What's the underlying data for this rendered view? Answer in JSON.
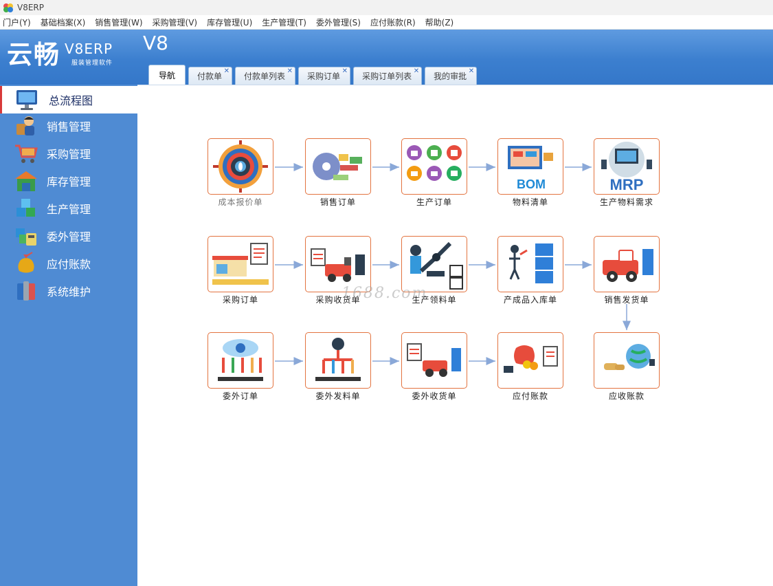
{
  "window": {
    "title": "V8ERP"
  },
  "menu": [
    "门户(Y)",
    "基础档案(X)",
    "销售管理(W)",
    "采购管理(V)",
    "库存管理(U)",
    "生产管理(T)",
    "委外管理(S)",
    "应付账款(R)",
    "帮助(Z)"
  ],
  "brand": {
    "name_cn": "云畅",
    "name_en": "V8ERP",
    "tagline": "服装管理软件",
    "version": "V8"
  },
  "tabs": [
    {
      "label": "导航",
      "closable": false,
      "active": true
    },
    {
      "label": "付款单",
      "closable": true
    },
    {
      "label": "付款单列表",
      "closable": true
    },
    {
      "label": "采购订单",
      "closable": true
    },
    {
      "label": "采购订单列表",
      "closable": true
    },
    {
      "label": "我的审批",
      "closable": true
    }
  ],
  "tab_close_glyph": "✕",
  "sidebar": [
    {
      "label": "总流程图",
      "icon": "monitor-icon",
      "active": true
    },
    {
      "label": "销售管理",
      "icon": "salesperson-icon"
    },
    {
      "label": "采购管理",
      "icon": "shopping-cart-icon"
    },
    {
      "label": "库存管理",
      "icon": "warehouse-icon"
    },
    {
      "label": "生产管理",
      "icon": "cubes-icon"
    },
    {
      "label": "委外管理",
      "icon": "outsource-icon"
    },
    {
      "label": "应付账款",
      "icon": "money-bag-icon"
    },
    {
      "label": "系统维护",
      "icon": "tools-icon"
    }
  ],
  "flow": {
    "row1": [
      {
        "label": "成本报价单",
        "icon": "color-wheel-icon",
        "muted": true
      },
      {
        "label": "销售订单",
        "icon": "sales-order-icon"
      },
      {
        "label": "生产订单",
        "icon": "garments-icon"
      },
      {
        "label": "物料清单",
        "icon": "bom-icon",
        "badge": "BOM"
      },
      {
        "label": "生产物料需求",
        "icon": "mrp-icon",
        "badge": "MRP"
      }
    ],
    "row2": [
      {
        "label": "采购订单",
        "icon": "store-icon"
      },
      {
        "label": "采购收货单",
        "icon": "truck-icon"
      },
      {
        "label": "生产领料单",
        "icon": "robot-arm-icon"
      },
      {
        "label": "产成品入库单",
        "icon": "storage-shelf-icon"
      },
      {
        "label": "销售发货单",
        "icon": "delivery-truck-icon"
      }
    ],
    "row3": [
      {
        "label": "委外订单",
        "icon": "outsource-cloud-icon"
      },
      {
        "label": "委外发料单",
        "icon": "outsource-material-icon"
      },
      {
        "label": "委外收货单",
        "icon": "outsource-truck-icon"
      },
      {
        "label": "应付账款",
        "icon": "payable-icon"
      },
      {
        "label": "应收账款",
        "icon": "receivable-icon"
      }
    ]
  },
  "watermark": "1688.com",
  "colors": {
    "sidebar": "#4f8bd3",
    "banner": "#3c7fcf",
    "node_border": "#e3733f",
    "arrow": "#8aa8d8"
  }
}
